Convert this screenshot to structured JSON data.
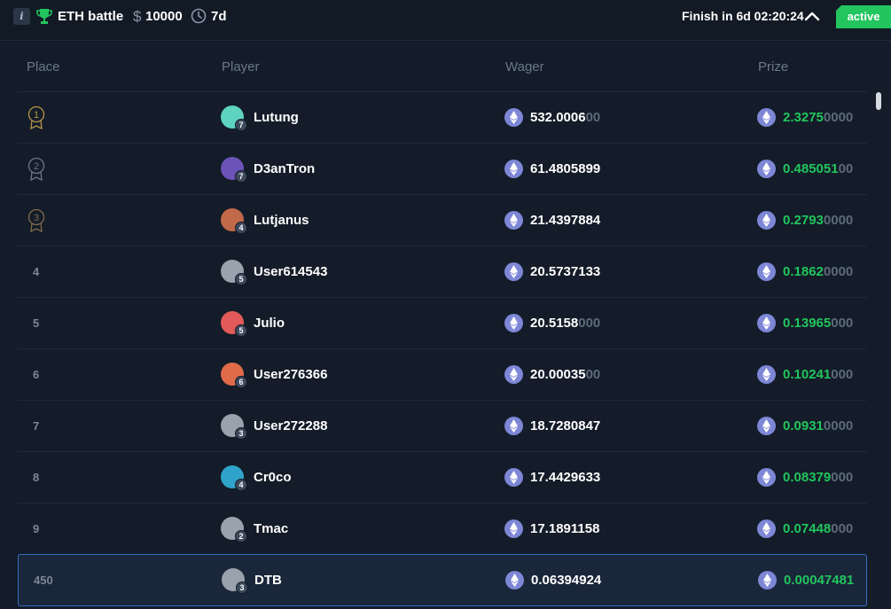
{
  "header": {
    "info_icon": "i",
    "title": "ETH battle",
    "currency_symbol": "$",
    "amount": "10000",
    "duration": "7d",
    "finish_text": "Finish in 6d 02:20:24",
    "status": "active",
    "colors": {
      "status": "#22c55e",
      "accent": "#3a6cc5",
      "prize": "#22c55e",
      "eth": "#7d87d6"
    }
  },
  "columns": {
    "place": "Place",
    "player": "Player",
    "wager": "Wager",
    "prize": "Prize"
  },
  "rows": [
    {
      "place": "1",
      "medal": "gold",
      "name": "Lutung",
      "level": "7",
      "avatar_color": "#5ed3c0",
      "wager_main": "532.0006",
      "wager_dim": "00",
      "prize_main": "2.3275",
      "prize_dim": "0000"
    },
    {
      "place": "2",
      "medal": "silver",
      "name": "D3anTron",
      "level": "7",
      "avatar_color": "#6b53b8",
      "wager_main": "61.4805899",
      "wager_dim": "",
      "prize_main": "0.485051",
      "prize_dim": "00"
    },
    {
      "place": "3",
      "medal": "bronze",
      "name": "Lutjanus",
      "level": "4",
      "avatar_color": "#c2694a",
      "wager_main": "21.4397884",
      "wager_dim": "",
      "prize_main": "0.2793",
      "prize_dim": "0000"
    },
    {
      "place": "4",
      "medal": "",
      "name": "User614543",
      "level": "5",
      "avatar_color": "#9aa3ad",
      "wager_main": "20.5737133",
      "wager_dim": "",
      "prize_main": "0.1862",
      "prize_dim": "0000"
    },
    {
      "place": "5",
      "medal": "",
      "name": "Julio",
      "level": "5",
      "avatar_color": "#e25a5a",
      "wager_main": "20.5158",
      "wager_dim": "000",
      "prize_main": "0.13965",
      "prize_dim": "000"
    },
    {
      "place": "6",
      "medal": "",
      "name": "User276366",
      "level": "6",
      "avatar_color": "#e06b4a",
      "wager_main": "20.00035",
      "wager_dim": "00",
      "prize_main": "0.10241",
      "prize_dim": "000"
    },
    {
      "place": "7",
      "medal": "",
      "name": "User272288",
      "level": "3",
      "avatar_color": "#9aa3ad",
      "wager_main": "18.7280847",
      "wager_dim": "",
      "prize_main": "0.0931",
      "prize_dim": "0000"
    },
    {
      "place": "8",
      "medal": "",
      "name": "Cr0co",
      "level": "4",
      "avatar_color": "#2fa3c9",
      "wager_main": "17.4429633",
      "wager_dim": "",
      "prize_main": "0.08379",
      "prize_dim": "000"
    },
    {
      "place": "9",
      "medal": "",
      "name": "Tmac",
      "level": "2",
      "avatar_color": "#9aa3ad",
      "wager_main": "17.1891158",
      "wager_dim": "",
      "prize_main": "0.07448",
      "prize_dim": "000"
    },
    {
      "place": "450",
      "medal": "",
      "name": "DTB",
      "level": "3",
      "avatar_color": "#9aa3ad",
      "wager_main": "0.06394924",
      "wager_dim": "",
      "prize_main": "0.00047481",
      "prize_dim": "",
      "current_user": true
    }
  ]
}
